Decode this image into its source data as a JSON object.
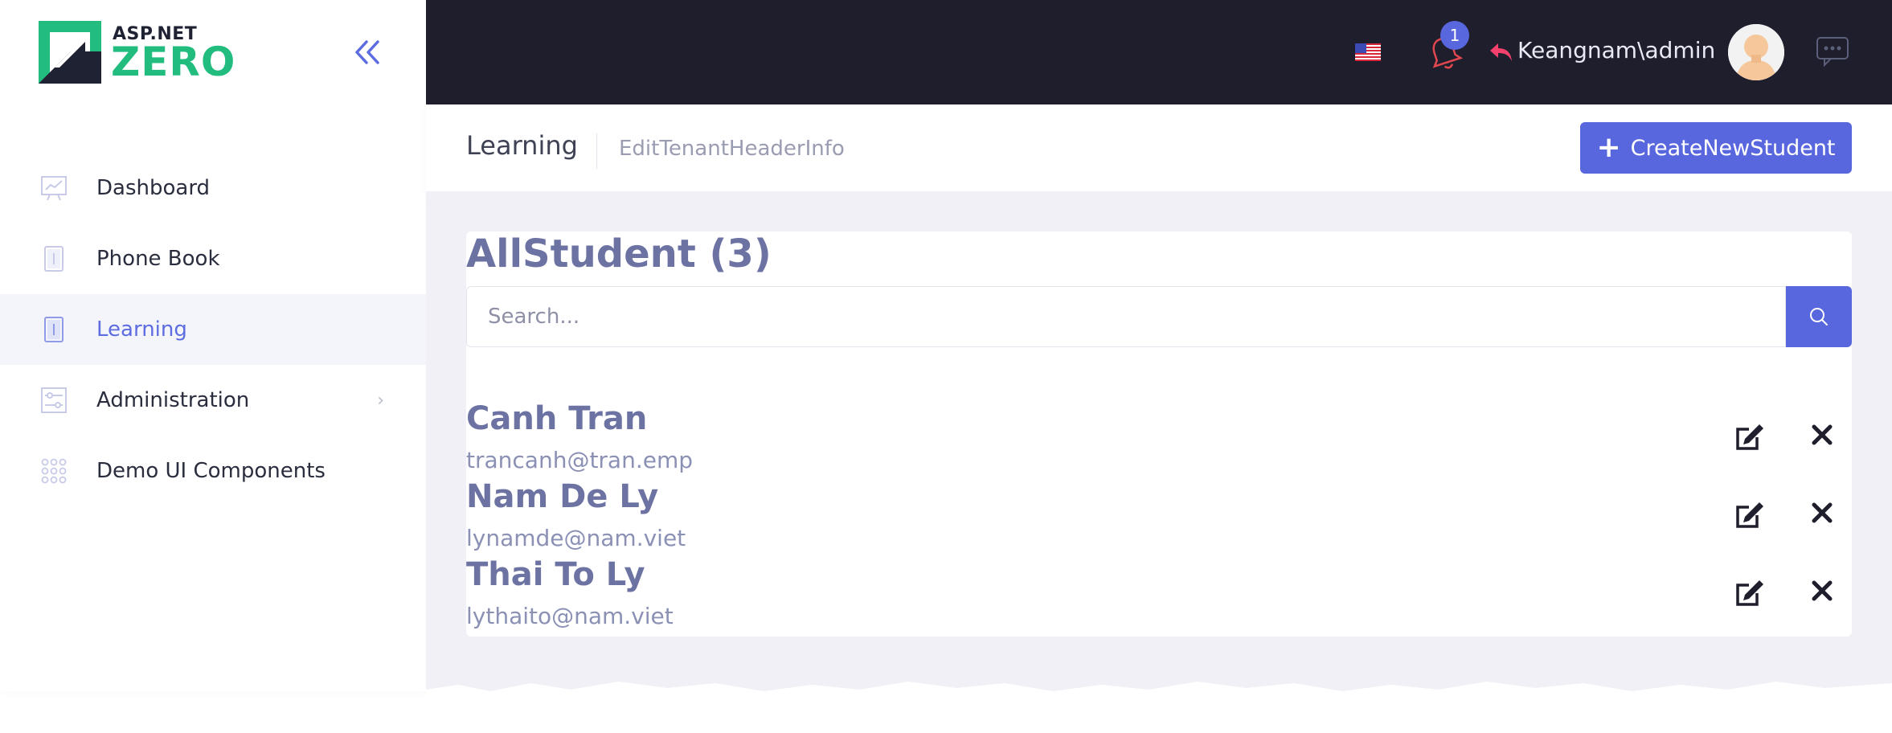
{
  "brand": {
    "top": "ASP.NET",
    "bottom": "ZERO"
  },
  "sidebar": {
    "items": [
      {
        "label": "Dashboard",
        "icon": "chart-icon"
      },
      {
        "label": "Phone Book",
        "icon": "book-icon"
      },
      {
        "label": "Learning",
        "icon": "book-icon",
        "active": true
      },
      {
        "label": "Administration",
        "icon": "sliders-icon",
        "has_submenu": true
      },
      {
        "label": "Demo UI Components",
        "icon": "grid-icon"
      }
    ]
  },
  "topbar": {
    "notification_count": "1",
    "user_name": "Keangnam\\admin"
  },
  "subheader": {
    "title": "Learning",
    "subtitle": "EditTenantHeaderInfo",
    "create_button": "CreateNewStudent"
  },
  "card": {
    "title": "AllStudent (3)",
    "search_placeholder": "Search..."
  },
  "students": [
    {
      "name": "Canh Tran",
      "email": "trancanh@tran.emp"
    },
    {
      "name": "Nam De Ly",
      "email": "lynamde@nam.viet"
    },
    {
      "name": "Thai To Ly",
      "email": "lythaito@nam.viet"
    }
  ],
  "colors": {
    "accent": "#5867dd",
    "topbar": "#1e1e2d",
    "brand_green": "#22bd7e",
    "heading": "#6c73a3"
  }
}
